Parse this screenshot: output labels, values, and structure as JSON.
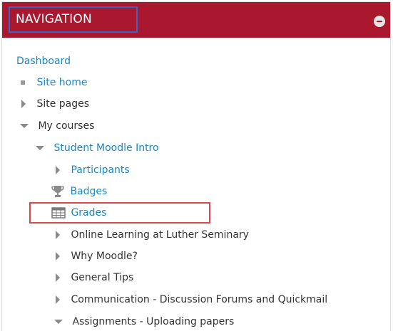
{
  "block": {
    "title": "NAVIGATION",
    "header_color": "#a9182f",
    "link_color": "#1a87c9"
  },
  "nav": {
    "dashboard": "Dashboard",
    "site_home": "Site home",
    "site_pages": "Site pages",
    "my_courses": "My courses",
    "course": "Student Moodle Intro",
    "participants": "Participants",
    "badges": "Badges",
    "grades": "Grades",
    "sections": [
      "Online Learning at Luther Seminary",
      "Why Moodle?",
      "General Tips",
      "Communication - Discussion Forums and Quickmail",
      "Assignments - Uploading papers"
    ]
  },
  "icons": {
    "collapse": "minus-circle-icon",
    "badges": "trophy-icon",
    "grades": "table-icon"
  }
}
